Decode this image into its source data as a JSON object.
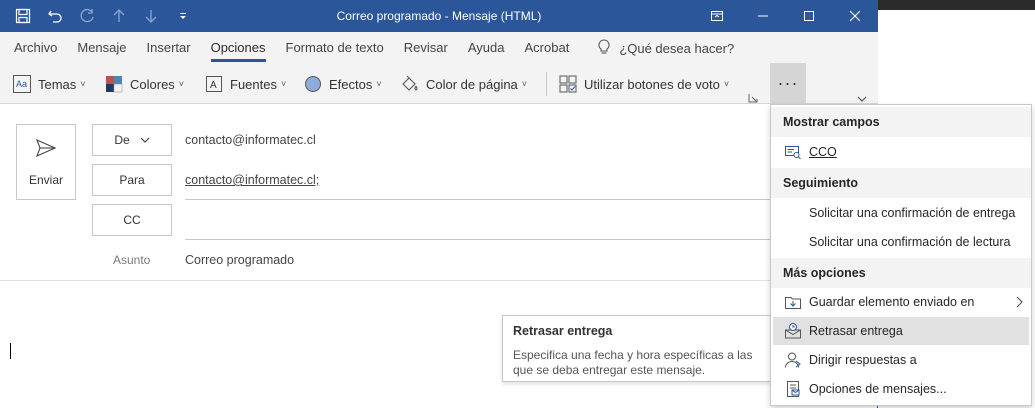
{
  "window": {
    "title": "Correo programado  -  Mensaje (HTML)"
  },
  "tabs": [
    {
      "label": "Archivo"
    },
    {
      "label": "Mensaje"
    },
    {
      "label": "Insertar"
    },
    {
      "label": "Opciones",
      "active": true
    },
    {
      "label": "Formato de texto"
    },
    {
      "label": "Revisar"
    },
    {
      "label": "Ayuda"
    },
    {
      "label": "Acrobat"
    }
  ],
  "tellme": {
    "label": "¿Qué desea hacer?"
  },
  "ribbon": {
    "temas": "Temas",
    "colores": "Colores",
    "fuentes": "Fuentes",
    "efectos": "Efectos",
    "color_pagina": "Color de página",
    "votos": "Utilizar botones de voto",
    "more": "···"
  },
  "compose": {
    "send_label": "Enviar",
    "from_label": "De",
    "from_value": "contacto@informatec.cl",
    "to_label": "Para",
    "to_value": "contacto@informatec.cl;",
    "cc_label": "CC",
    "subject_label": "Asunto",
    "subject_value": "Correo programado"
  },
  "tooltip": {
    "title": "Retrasar entrega",
    "body": "Especifica una fecha y hora específicas a las que se deba entregar este mensaje."
  },
  "menu": {
    "section_fields": "Mostrar campos",
    "cco": "CCO",
    "section_tracking": "Seguimiento",
    "delivery_receipt": "Solicitar una confirmación de entrega",
    "read_receipt": "Solicitar una confirmación de lectura",
    "section_more": "Más opciones",
    "save_sent": "Guardar elemento enviado en",
    "delay_delivery": "Retrasar entrega",
    "direct_replies": "Dirigir respuestas a",
    "message_options": "Opciones de mensajes..."
  },
  "colors": {
    "titlebar": "#2b579a",
    "ribbon_bg": "#f3f3f3",
    "menu_hover": "#e1e1e1"
  }
}
